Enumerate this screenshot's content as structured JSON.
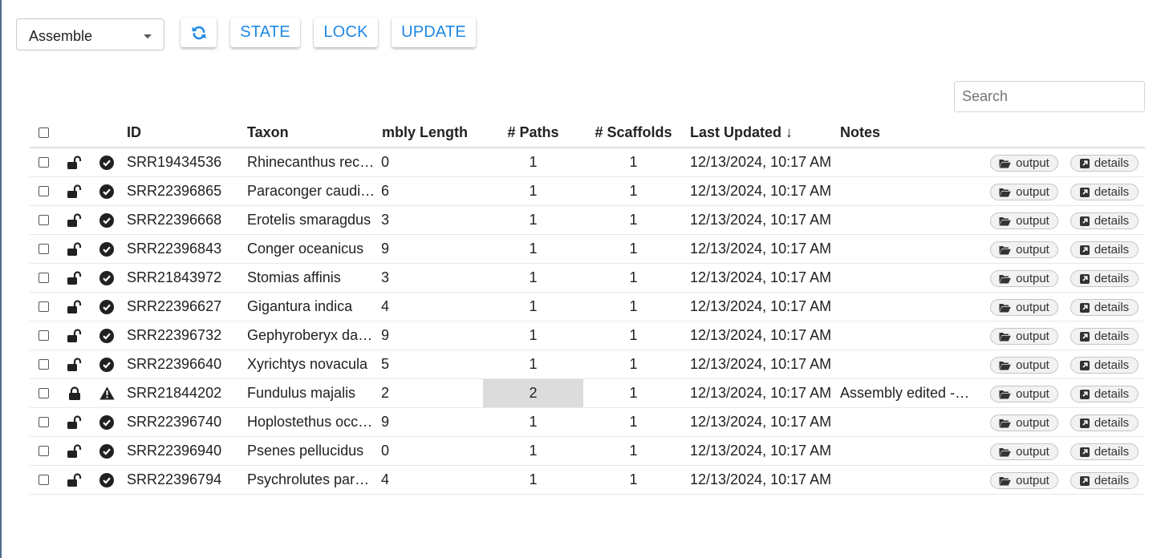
{
  "toolbar": {
    "select_value": "Assemble",
    "state_label": "STATE",
    "lock_label": "LOCK",
    "update_label": "UPDATE"
  },
  "search": {
    "placeholder": "Search"
  },
  "table": {
    "headers": {
      "id": "ID",
      "taxon": "Taxon",
      "assembly_length": "mbly Length",
      "paths": "# Paths",
      "scaffolds": "# Scaffolds",
      "last_updated": "Last Updated ↓",
      "notes": "Notes"
    },
    "output_label": "output",
    "details_label": "details",
    "rows": [
      {
        "lock": "unlocked",
        "status": "ok",
        "id": "SRR19434536",
        "taxon": "Rhinecanthus rectangulus",
        "length": "0",
        "paths": "1",
        "scaffolds": "1",
        "updated": "12/13/2024, 10:17 AM",
        "notes": "",
        "highlight": false
      },
      {
        "lock": "unlocked",
        "status": "ok",
        "id": "SRR22396865",
        "taxon": "Paraconger caudilimbatus",
        "length": "6",
        "paths": "1",
        "scaffolds": "1",
        "updated": "12/13/2024, 10:17 AM",
        "notes": "",
        "highlight": false
      },
      {
        "lock": "unlocked",
        "status": "ok",
        "id": "SRR22396668",
        "taxon": "Erotelis smaragdus",
        "length": "3",
        "paths": "1",
        "scaffolds": "1",
        "updated": "12/13/2024, 10:17 AM",
        "notes": "",
        "highlight": false
      },
      {
        "lock": "unlocked",
        "status": "ok",
        "id": "SRR22396843",
        "taxon": "Conger oceanicus",
        "length": "9",
        "paths": "1",
        "scaffolds": "1",
        "updated": "12/13/2024, 10:17 AM",
        "notes": "",
        "highlight": false
      },
      {
        "lock": "unlocked",
        "status": "ok",
        "id": "SRR21843972",
        "taxon": "Stomias affinis",
        "length": "3",
        "paths": "1",
        "scaffolds": "1",
        "updated": "12/13/2024, 10:17 AM",
        "notes": "",
        "highlight": false
      },
      {
        "lock": "unlocked",
        "status": "ok",
        "id": "SRR22396627",
        "taxon": "Gigantura indica",
        "length": "4",
        "paths": "1",
        "scaffolds": "1",
        "updated": "12/13/2024, 10:17 AM",
        "notes": "",
        "highlight": false
      },
      {
        "lock": "unlocked",
        "status": "ok",
        "id": "SRR22396732",
        "taxon": "Gephyroberyx darwinii",
        "length": "9",
        "paths": "1",
        "scaffolds": "1",
        "updated": "12/13/2024, 10:17 AM",
        "notes": "",
        "highlight": false
      },
      {
        "lock": "unlocked",
        "status": "ok",
        "id": "SRR22396640",
        "taxon": "Xyrichtys novacula",
        "length": "5",
        "paths": "1",
        "scaffolds": "1",
        "updated": "12/13/2024, 10:17 AM",
        "notes": "",
        "highlight": false
      },
      {
        "lock": "locked",
        "status": "warning",
        "id": "SRR21844202",
        "taxon": "Fundulus majalis",
        "length": "2",
        "paths": "2",
        "scaffolds": "1",
        "updated": "12/13/2024, 10:17 AM",
        "notes": "Assembly edited - paths",
        "highlight": true
      },
      {
        "lock": "unlocked",
        "status": "ok",
        "id": "SRR22396740",
        "taxon": "Hoplostethus occidentalis",
        "length": "9",
        "paths": "1",
        "scaffolds": "1",
        "updated": "12/13/2024, 10:17 AM",
        "notes": "",
        "highlight": false
      },
      {
        "lock": "unlocked",
        "status": "ok",
        "id": "SRR22396940",
        "taxon": "Psenes pellucidus",
        "length": "0",
        "paths": "1",
        "scaffolds": "1",
        "updated": "12/13/2024, 10:17 AM",
        "notes": "",
        "highlight": false
      },
      {
        "lock": "unlocked",
        "status": "ok",
        "id": "SRR22396794",
        "taxon": "Psychrolutes paradoxus",
        "length": "4",
        "paths": "1",
        "scaffolds": "1",
        "updated": "12/13/2024, 10:17 AM",
        "notes": "",
        "highlight": false
      }
    ]
  }
}
